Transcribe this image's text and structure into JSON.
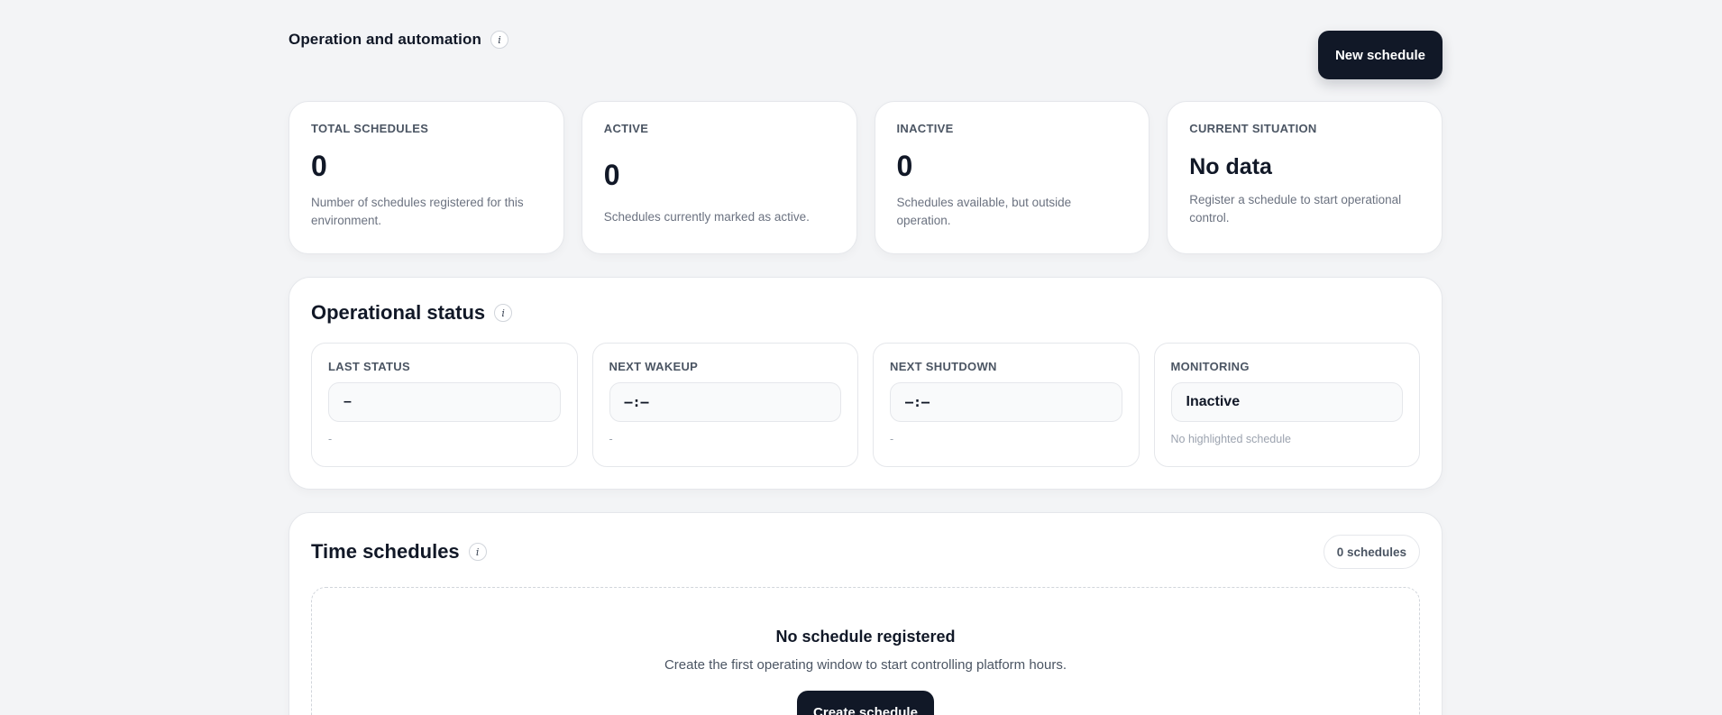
{
  "header": {
    "title": "Operation and automation",
    "new_button_label": "New schedule"
  },
  "stats": [
    {
      "label": "TOTAL SCHEDULES",
      "value": "0",
      "description": "Number of schedules registered for this environment."
    },
    {
      "label": "ACTIVE",
      "value": "0",
      "description": "Schedules currently marked as active."
    },
    {
      "label": "INACTIVE",
      "value": "0",
      "description": "Schedules available, but outside operation."
    },
    {
      "label": "CURRENT SITUATION",
      "value": "No data",
      "description": "Register a schedule to start operational control."
    }
  ],
  "operational_status": {
    "title": "Operational status",
    "cards": [
      {
        "label": "LAST STATUS",
        "value": "–",
        "note": "-"
      },
      {
        "label": "NEXT WAKEUP",
        "value": "–:–",
        "note": "-"
      },
      {
        "label": "NEXT SHUTDOWN",
        "value": "–:–",
        "note": "-"
      },
      {
        "label": "MONITORING",
        "value": "Inactive",
        "note": "No highlighted schedule"
      }
    ]
  },
  "time_schedules": {
    "title": "Time schedules",
    "count_label": "0 schedules",
    "empty_title": "No schedule registered",
    "empty_description": "Create the first operating window to start controlling platform hours.",
    "create_button_label": "Create schedule"
  },
  "icons": {
    "info": "info-icon"
  },
  "colors": {
    "primary": "#111827",
    "background": "#f3f4f6",
    "muted": "#6b7280"
  }
}
